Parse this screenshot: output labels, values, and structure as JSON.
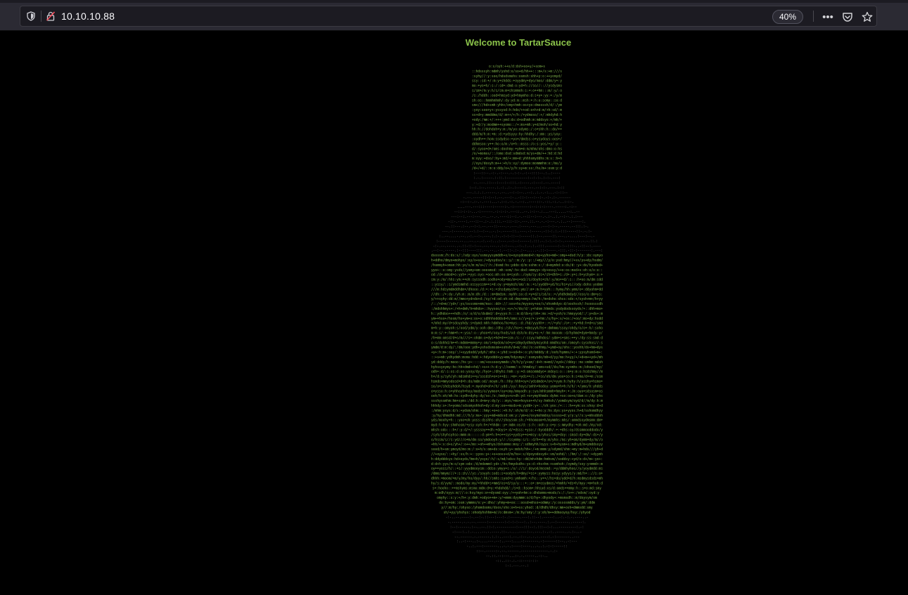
{
  "browser": {
    "url": "10.10.10.88",
    "zoom": "40%",
    "icons": {
      "tracking": "shield-icon",
      "insecure": "insecure-lock-icon",
      "menu": "page-actions-icon",
      "pocket": "pocket-icon",
      "bookmark": "star-icon"
    }
  },
  "page": {
    "heading": "Welcome to TartarSauce",
    "heading_color": "#8bc34a",
    "background": "#000000",
    "ascii_color": "#7fb24a",
    "ascii_dim_color": "#6b6b6b"
  }
}
